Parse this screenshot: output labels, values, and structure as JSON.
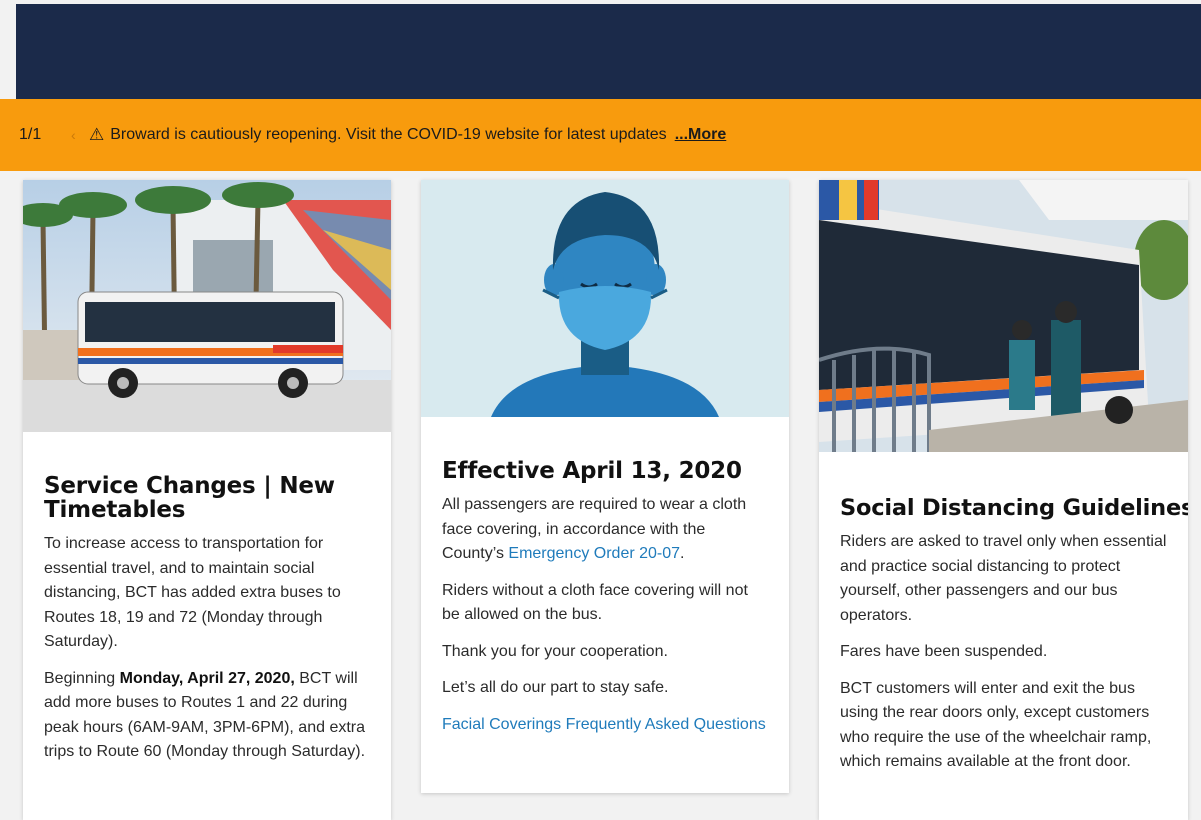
{
  "alert": {
    "counter": "1/1",
    "prev_icon": "chevron-left-icon",
    "warning_icon": "⚠",
    "message": "Broward is cautiously reopening. Visit the COVID-19 website for latest updates",
    "more_label": "...More"
  },
  "cards": [
    {
      "title": "Service Changes | New Timetables",
      "p1": "To increase access to transportation for essential travel, and to maintain social distancing, BCT has added extra buses to Routes 18, 19 and 72 (Monday through Saturday).",
      "p2_pre": "Beginning ",
      "p2_bold": "Monday, April 27, 2020,",
      "p2_post": " BCT will add more buses to Routes 1 and 22 during peak hours (6AM-9AM, 3PM-6PM), and extra trips to Route 60 (Monday through Saturday)."
    },
    {
      "title": "Effective April 13, 2020",
      "p1_pre": "All passengers are required to wear a cloth face covering, in accordance with the County’s ",
      "p1_link": "Emergency Order 20-07",
      "p1_post": ".",
      "p2": "Riders without a cloth face covering will not be allowed on the bus.",
      "p3": "Thank you for your cooperation.",
      "p4": "Let’s all do our part to stay safe.",
      "link": "Facial Coverings Frequently Asked Questions"
    },
    {
      "title": "Social Distancing Guidelines",
      "p1": "Riders are asked to travel only when essential and practice social distancing to protect yourself, other passengers and our bus operators.",
      "p2": "Fares have been suspended.",
      "p3": "BCT customers will enter and exit the bus using the rear doors only, except customers who require the use of the wheelchair ramp, which remains available at the front door."
    }
  ],
  "colors": {
    "header": "#1b2a4a",
    "alert": "#f89b0d",
    "link": "#1f7bbb"
  }
}
